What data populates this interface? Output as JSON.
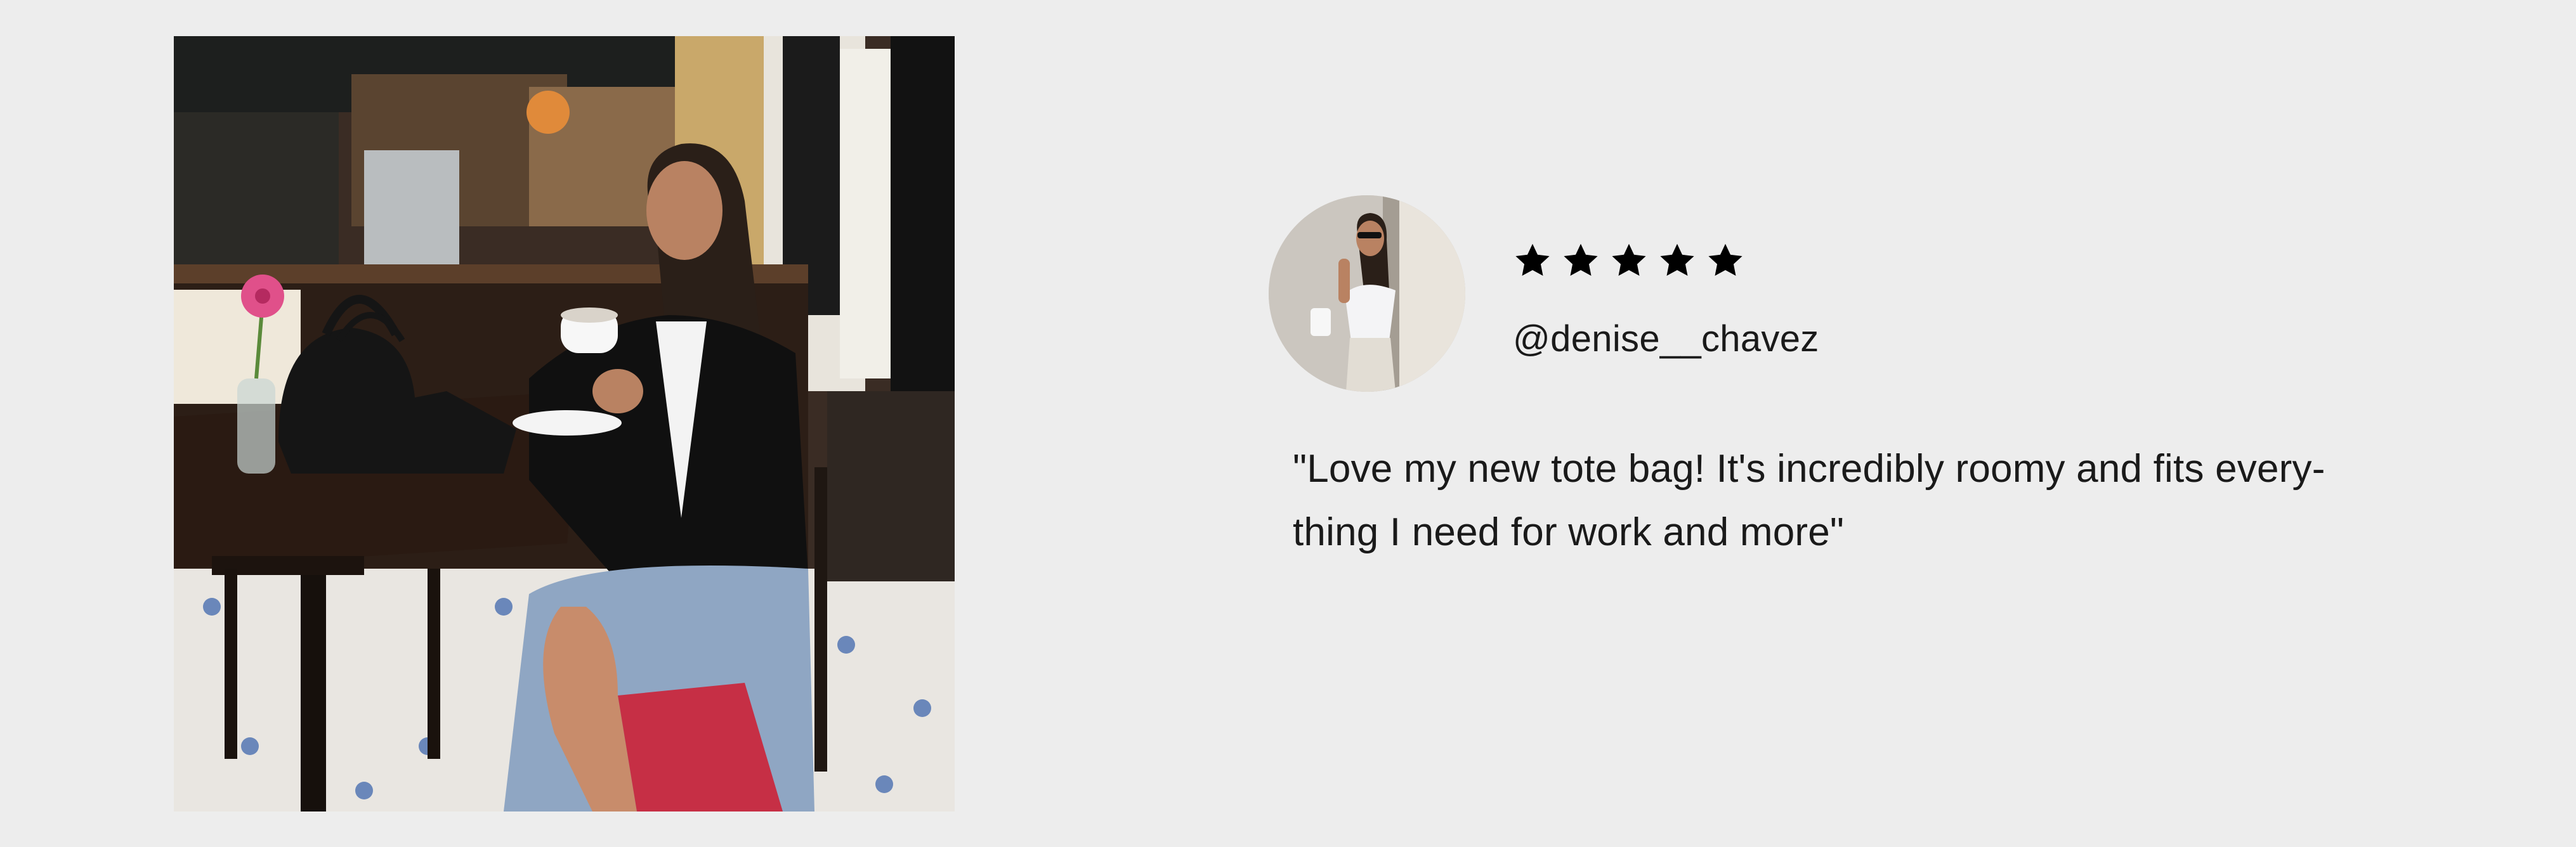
{
  "photo": {
    "icon": "cafe-photo-woman-with-tote-bag"
  },
  "review": {
    "avatar_icon": "reviewer-avatar-photo",
    "rating": 5,
    "rating_max": 5,
    "star_icon": "star-icon",
    "star_color": "#000000",
    "handle": "@denise__chavez",
    "quote_line1": "\"Love my new tote bag! It's incredibly roomy and fits every-",
    "quote_line2": "thing I need for work and more\""
  },
  "colors": {
    "background": "#ededed",
    "text": "#1a1a1a"
  }
}
